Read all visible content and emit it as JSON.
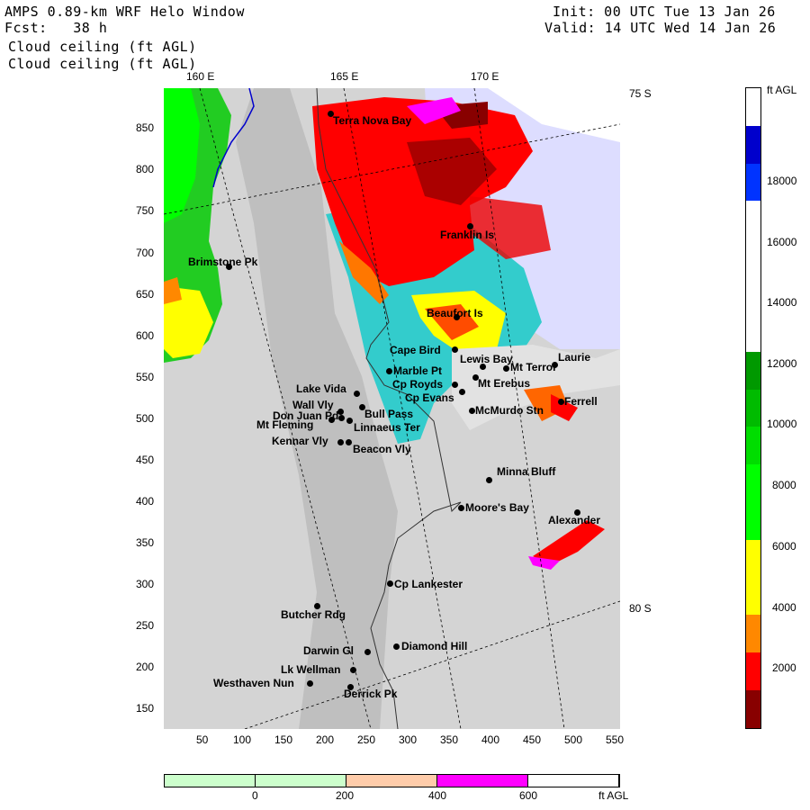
{
  "header": {
    "title": "AMPS 0.89-km WRF Helo Window",
    "forecast": "Fcst:   38 h",
    "field1": "Cloud ceiling (ft AGL)",
    "field2": "Cloud ceiling (ft AGL)",
    "init": "Init: 00 UTC Tue 13 Jan 26",
    "valid": "Valid: 14 UTC Wed 14 Jan 26"
  },
  "axes": {
    "lon_labels": [
      "160 E",
      "165 E",
      "170 E"
    ],
    "lat_labels": [
      "75 S",
      "80 S"
    ],
    "x_ticks": [
      "50",
      "100",
      "150",
      "200",
      "250",
      "300",
      "350",
      "400",
      "450",
      "500",
      "550"
    ],
    "y_ticks": [
      "850",
      "800",
      "750",
      "700",
      "650",
      "600",
      "550",
      "500",
      "450",
      "400",
      "350",
      "300",
      "250",
      "200",
      "150"
    ]
  },
  "stations": [
    {
      "name": "Terra Nova Bay"
    },
    {
      "name": "Franklin Is"
    },
    {
      "name": "Brimstone Pk"
    },
    {
      "name": "Beaufort Is"
    },
    {
      "name": "Cape Bird"
    },
    {
      "name": "Lewis Bay"
    },
    {
      "name": "Laurie"
    },
    {
      "name": "Mt Terror"
    },
    {
      "name": "Marble Pt"
    },
    {
      "name": "Cp Royds"
    },
    {
      "name": "Mt Erebus"
    },
    {
      "name": "Lake Vida"
    },
    {
      "name": "Cp Evans"
    },
    {
      "name": "Wall Vly"
    },
    {
      "name": "Ferrell"
    },
    {
      "name": "Don Juan Pd"
    },
    {
      "name": "Bull Pass"
    },
    {
      "name": "McMurdo Stn"
    },
    {
      "name": "Mt Fleming"
    },
    {
      "name": "Linnaeus Ter"
    },
    {
      "name": "Kennar Vly"
    },
    {
      "name": "Beacon Vly"
    },
    {
      "name": "Minna Bluff"
    },
    {
      "name": "Moore's Bay"
    },
    {
      "name": "Alexander"
    },
    {
      "name": "Cp Lankester"
    },
    {
      "name": "Butcher Rdg"
    },
    {
      "name": "Diamond Hill"
    },
    {
      "name": "Darwin Gl"
    },
    {
      "name": "Lk Wellman"
    },
    {
      "name": "Westhaven Nun"
    },
    {
      "name": "Derrick Pk"
    }
  ],
  "colorbar": {
    "unit": "ft AGL",
    "labels": [
      "18000",
      "16000",
      "14000",
      "12000",
      "10000",
      "8000",
      "6000",
      "4000",
      "2000"
    ],
    "colors": [
      "#ffffff",
      "#0000cc",
      "#0033ff",
      "#ffffff",
      "#ffffff",
      "#ffffff",
      "#ffffff",
      "#009900",
      "#00bb00",
      "#00dd00",
      "#00ff00",
      "#00ff00",
      "#ffff00",
      "#ffff00",
      "#ff8800",
      "#ff0000",
      "#880000"
    ]
  },
  "low_colorbar": {
    "unit": "ft AGL",
    "labels": [
      "0",
      "200",
      "400",
      "600"
    ],
    "colors": [
      "#ccffcc",
      "#ccffcc",
      "#ffccaa",
      "#ff00ff",
      "#ffffff"
    ]
  },
  "colors": {
    "ocean": "#d0d0d0",
    "ice_shelf": "#d8d8d8",
    "sea_cyan": "#33cccc",
    "lavender": "#ddddff"
  }
}
